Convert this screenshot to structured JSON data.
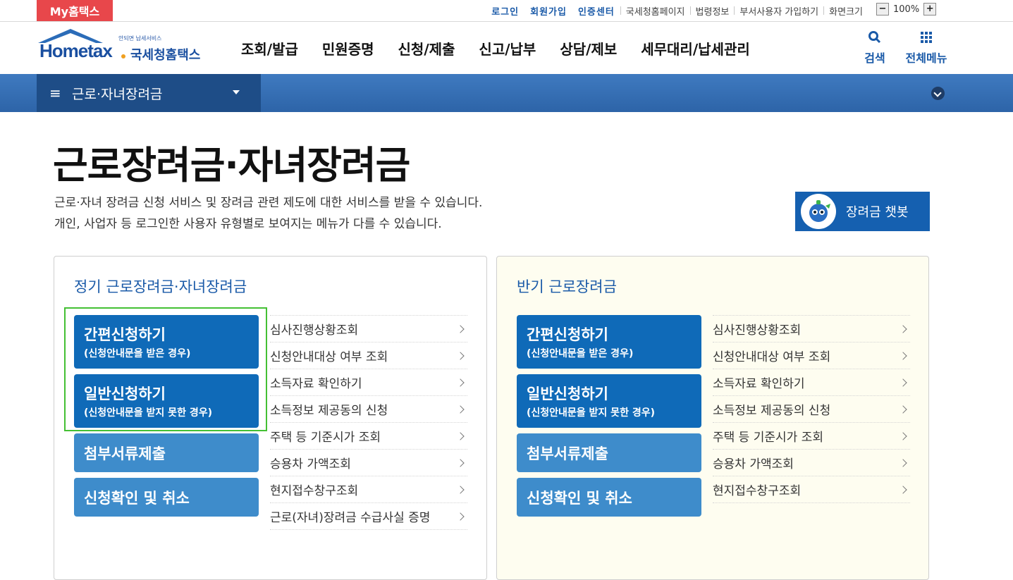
{
  "topbar": {
    "my_tab": "My홈택스",
    "primary_links": [
      "로그인",
      "회원가입",
      "인증센터"
    ],
    "secondary_links": [
      "국세청홈페이지",
      "법령정보",
      "부서사용자 가입하기",
      "화면크기"
    ],
    "zoom": "100%",
    "zoom_minus": "−",
    "zoom_plus": "+"
  },
  "header": {
    "logo_tag": "안되면 납세서비스",
    "logo_word": "Hometax",
    "logo_kr": "국세청홈택스",
    "nav": [
      "조회/발급",
      "민원증명",
      "신청/제출",
      "신고/납부",
      "상담/제보",
      "세무대리/납세관리"
    ],
    "search_label": "검색",
    "all_menu_label": "전체메뉴"
  },
  "band": {
    "menu_glyph": "≡",
    "current": "근로·자녀장려금"
  },
  "page": {
    "title": "근로장려금·자녀장려금",
    "desc_line1": "근로·자녀 장려금 신청 서비스 및 장려금 관련 제도에 대한 서비스를 받을 수 있습니다.",
    "desc_line2": "개인, 사업자 등 로그인한 사용자 유형별로 보여지는 메뉴가 다를 수 있습니다.",
    "chatbot": "장려금 챗봇"
  },
  "left_panel": {
    "title": "정기 근로장려금·자녀장려금",
    "buttons": [
      {
        "main": "간편신청하기",
        "sub": "(신청안내문을 받은 경우)"
      },
      {
        "main": "일반신청하기",
        "sub": "(신청안내문을 받지 못한 경우)"
      },
      {
        "main": "첨부서류제출",
        "sub": ""
      },
      {
        "main": "신청확인 및 취소",
        "sub": ""
      }
    ],
    "links": [
      "심사진행상황조회",
      "신청안내대상 여부 조회",
      "소득자료 확인하기",
      "소득정보 제공동의 신청",
      "주택 등 기준시가 조회",
      "승용차 가액조회",
      "현지접수창구조회",
      "근로(자녀)장려금 수급사실 증명"
    ]
  },
  "right_panel": {
    "title": "반기 근로장려금",
    "buttons": [
      {
        "main": "간편신청하기",
        "sub": "(신청안내문을 받은 경우)"
      },
      {
        "main": "일반신청하기",
        "sub": "(신청안내문을 받지 못한 경우)"
      },
      {
        "main": "첨부서류제출",
        "sub": ""
      },
      {
        "main": "신청확인 및 취소",
        "sub": ""
      }
    ],
    "links": [
      "심사진행상황조회",
      "신청안내대상 여부 조회",
      "소득자료 확인하기",
      "소득정보 제공동의 신청",
      "주택 등 기준시가 조회",
      "승용차 가액조회",
      "현지접수창구조회"
    ]
  },
  "colors": {
    "brand_blue": "#1a5aa8",
    "button_dark": "#0f6ab8",
    "button_light": "#3e8ccb",
    "highlight": "#44c034",
    "my_tab": "#e8474b"
  }
}
